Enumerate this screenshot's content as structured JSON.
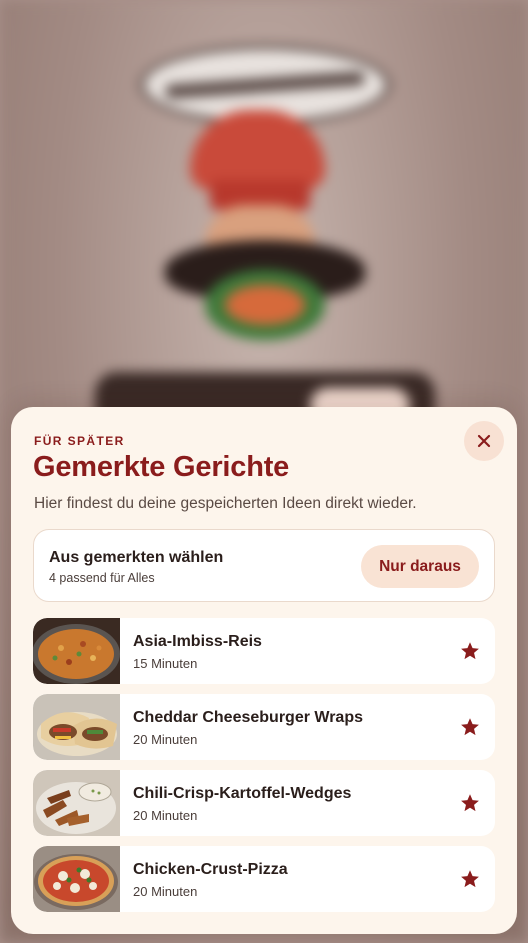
{
  "sheet": {
    "eyebrow": "FÜR SPÄTER",
    "title": "Gemerkte Gerichte",
    "subtitle": "Hier findest du deine gespeicherten Ideen direkt wieder.",
    "close_icon": "close-icon"
  },
  "choose": {
    "title": "Aus gemerkten wählen",
    "count_text": "4 passend für Alles",
    "button_label": "Nur daraus"
  },
  "recipes": [
    {
      "name": "Asia-Imbiss-Reis",
      "time": "15 Minuten",
      "thumb_icon": "fried-rice-image",
      "starred": true
    },
    {
      "name": "Cheddar Cheeseburger Wraps",
      "time": "20 Minuten",
      "thumb_icon": "wraps-image",
      "starred": true
    },
    {
      "name": "Chili-Crisp-Kartoffel-Wedges",
      "time": "20 Minuten",
      "thumb_icon": "potato-wedges-image",
      "starred": true
    },
    {
      "name": "Chicken-Crust-Pizza",
      "time": "20 Minuten",
      "thumb_icon": "pizza-image",
      "starred": true
    }
  ],
  "colors": {
    "accent": "#8a1c1c",
    "sheet_bg": "#fdf5ec",
    "pill_bg": "#f9e3d4"
  }
}
